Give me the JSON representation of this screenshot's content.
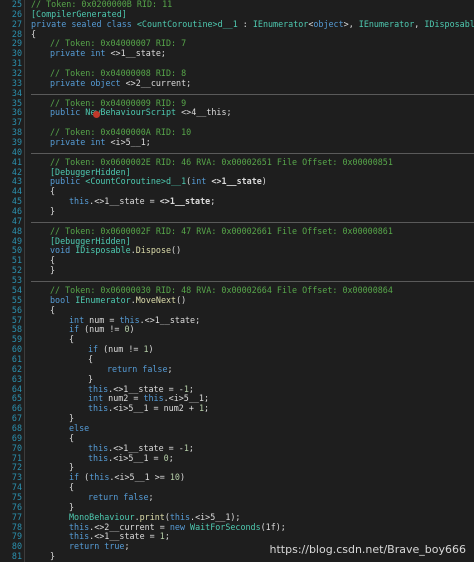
{
  "editor": {
    "lines": [
      {
        "n": "25",
        "i": 1,
        "segs": [
          [
            "c",
            "// Token: 0x0200000B RID: 11"
          ]
        ]
      },
      {
        "n": "26",
        "i": 1,
        "segs": [
          [
            "a",
            "[CompilerGenerated]"
          ]
        ]
      },
      {
        "n": "27",
        "i": 1,
        "segs": [
          [
            "k",
            "private sealed class "
          ],
          [
            "t",
            "<CountCoroutine>d__1"
          ],
          [
            "p",
            " : "
          ],
          [
            "t",
            "IEnumerator"
          ],
          [
            "p",
            "<"
          ],
          [
            "k",
            "object"
          ],
          [
            "p",
            ">, "
          ],
          [
            "t",
            "IEnumerator"
          ],
          [
            "p",
            ", "
          ],
          [
            "t",
            "IDisposable"
          ]
        ]
      },
      {
        "n": "28",
        "i": 1,
        "segs": [
          [
            "p",
            "{"
          ]
        ]
      },
      {
        "n": "29",
        "i": 2,
        "segs": [
          [
            "c",
            "// Token: 0x04000007 RID: 7"
          ]
        ]
      },
      {
        "n": "30",
        "i": 2,
        "segs": [
          [
            "k",
            "private int "
          ],
          [
            "p",
            "<>1__state;"
          ]
        ]
      },
      {
        "n": "31",
        "i": 0,
        "segs": []
      },
      {
        "n": "32",
        "i": 2,
        "segs": [
          [
            "c",
            "// Token: 0x04000008 RID: 8"
          ]
        ]
      },
      {
        "n": "33",
        "i": 2,
        "segs": [
          [
            "k",
            "private object "
          ],
          [
            "p",
            "<>2__current;"
          ]
        ]
      },
      {
        "n": "34",
        "i": 0,
        "segs": []
      },
      {
        "n": "35",
        "i": 2,
        "segs": [
          [
            "c",
            "// Token: 0x04000009 RID: 9"
          ]
        ]
      },
      {
        "n": "36",
        "i": 2,
        "segs": [
          [
            "k",
            "public "
          ],
          [
            "t",
            "NewBehaviourScript"
          ],
          [
            "p",
            " <>4__this;"
          ]
        ]
      },
      {
        "n": "37",
        "i": 0,
        "segs": []
      },
      {
        "n": "38",
        "i": 2,
        "segs": [
          [
            "c",
            "// Token: 0x0400000A RID: 10"
          ]
        ]
      },
      {
        "n": "39",
        "i": 2,
        "segs": [
          [
            "k",
            "private int "
          ],
          [
            "p",
            "<i>5__1;"
          ]
        ]
      },
      {
        "n": "40",
        "i": 0,
        "segs": []
      },
      {
        "n": "41",
        "i": 2,
        "segs": [
          [
            "c",
            "// Token: 0x0600002E RID: 46 RVA: 0x00002651 File Offset: 0x00000851"
          ]
        ]
      },
      {
        "n": "42",
        "i": 2,
        "segs": [
          [
            "a",
            "[DebuggerHidden]"
          ]
        ]
      },
      {
        "n": "43",
        "i": 2,
        "segs": [
          [
            "k",
            "public "
          ],
          [
            "t",
            "<CountCoroutine>d__1"
          ],
          [
            "p",
            "("
          ],
          [
            "k",
            "int "
          ],
          [
            "bold",
            "<>1__state"
          ],
          [
            "p",
            ")"
          ]
        ]
      },
      {
        "n": "44",
        "i": 2,
        "segs": [
          [
            "p",
            "{"
          ]
        ]
      },
      {
        "n": "45",
        "i": 3,
        "segs": [
          [
            "k",
            "this"
          ],
          [
            "p",
            ".<>1__state = "
          ],
          [
            "bold",
            "<>1__state"
          ],
          [
            "p",
            ";"
          ]
        ]
      },
      {
        "n": "46",
        "i": 2,
        "segs": [
          [
            "p",
            "}"
          ]
        ]
      },
      {
        "n": "47",
        "i": 0,
        "segs": []
      },
      {
        "n": "48",
        "i": 2,
        "segs": [
          [
            "c",
            "// Token: 0x0600002F RID: 47 RVA: 0x00002661 File Offset: 0x00000861"
          ]
        ]
      },
      {
        "n": "49",
        "i": 2,
        "segs": [
          [
            "a",
            "[DebuggerHidden]"
          ]
        ]
      },
      {
        "n": "50",
        "i": 2,
        "segs": [
          [
            "k",
            "void "
          ],
          [
            "t",
            "IDisposable"
          ],
          [
            "p",
            "."
          ],
          [
            "m",
            "Dispose"
          ],
          [
            "p",
            "()"
          ]
        ]
      },
      {
        "n": "51",
        "i": 2,
        "segs": [
          [
            "p",
            "{"
          ]
        ]
      },
      {
        "n": "52",
        "i": 2,
        "segs": [
          [
            "p",
            "}"
          ]
        ]
      },
      {
        "n": "53",
        "i": 0,
        "segs": []
      },
      {
        "n": "54",
        "i": 2,
        "segs": [
          [
            "c",
            "// Token: 0x06000030 RID: 48 RVA: 0x00002664 File Offset: 0x00000864"
          ]
        ]
      },
      {
        "n": "55",
        "i": 2,
        "segs": [
          [
            "k",
            "bool "
          ],
          [
            "t",
            "IEnumerator"
          ],
          [
            "p",
            "."
          ],
          [
            "m",
            "MoveNext"
          ],
          [
            "p",
            "()"
          ]
        ]
      },
      {
        "n": "56",
        "i": 2,
        "segs": [
          [
            "p",
            "{"
          ]
        ]
      },
      {
        "n": "57",
        "i": 3,
        "segs": [
          [
            "k",
            "int "
          ],
          [
            "p",
            "num = "
          ],
          [
            "k",
            "this"
          ],
          [
            "p",
            ".<>1__state;"
          ]
        ]
      },
      {
        "n": "58",
        "i": 3,
        "segs": [
          [
            "k",
            "if "
          ],
          [
            "p",
            "(num != "
          ],
          [
            "n",
            "0"
          ],
          [
            "p",
            ")"
          ]
        ]
      },
      {
        "n": "59",
        "i": 3,
        "segs": [
          [
            "p",
            "{"
          ]
        ]
      },
      {
        "n": "60",
        "i": 4,
        "segs": [
          [
            "k",
            "if "
          ],
          [
            "p",
            "(num != "
          ],
          [
            "n",
            "1"
          ],
          [
            "p",
            ")"
          ]
        ]
      },
      {
        "n": "61",
        "i": 4,
        "segs": [
          [
            "p",
            "{"
          ]
        ]
      },
      {
        "n": "62",
        "i": 5,
        "segs": [
          [
            "k",
            "return false"
          ],
          [
            "p",
            ";"
          ]
        ]
      },
      {
        "n": "63",
        "i": 4,
        "segs": [
          [
            "p",
            "}"
          ]
        ]
      },
      {
        "n": "64",
        "i": 4,
        "segs": [
          [
            "k",
            "this"
          ],
          [
            "p",
            ".<>1__state = -"
          ],
          [
            "n",
            "1"
          ],
          [
            "p",
            ";"
          ]
        ]
      },
      {
        "n": "65",
        "i": 4,
        "segs": [
          [
            "k",
            "int "
          ],
          [
            "p",
            "num2 = "
          ],
          [
            "k",
            "this"
          ],
          [
            "p",
            ".<i>5__1;"
          ]
        ]
      },
      {
        "n": "66",
        "i": 4,
        "segs": [
          [
            "k",
            "this"
          ],
          [
            "p",
            ".<i>5__1 = num2 + "
          ],
          [
            "n",
            "1"
          ],
          [
            "p",
            ";"
          ]
        ]
      },
      {
        "n": "67",
        "i": 3,
        "segs": [
          [
            "p",
            "}"
          ]
        ]
      },
      {
        "n": "68",
        "i": 3,
        "segs": [
          [
            "k",
            "else"
          ]
        ]
      },
      {
        "n": "69",
        "i": 3,
        "segs": [
          [
            "p",
            "{"
          ]
        ]
      },
      {
        "n": "70",
        "i": 4,
        "segs": [
          [
            "k",
            "this"
          ],
          [
            "p",
            ".<>1__state = -"
          ],
          [
            "n",
            "1"
          ],
          [
            "p",
            ";"
          ]
        ]
      },
      {
        "n": "71",
        "i": 4,
        "segs": [
          [
            "k",
            "this"
          ],
          [
            "p",
            ".<i>5__1 = "
          ],
          [
            "n",
            "0"
          ],
          [
            "p",
            ";"
          ]
        ]
      },
      {
        "n": "72",
        "i": 3,
        "segs": [
          [
            "p",
            "}"
          ]
        ]
      },
      {
        "n": "73",
        "i": 3,
        "segs": [
          [
            "k",
            "if "
          ],
          [
            "p",
            "("
          ],
          [
            "k",
            "this"
          ],
          [
            "p",
            ".<i>5__1 >= "
          ],
          [
            "n",
            "10"
          ],
          [
            "p",
            ")"
          ]
        ]
      },
      {
        "n": "74",
        "i": 3,
        "segs": [
          [
            "p",
            "{"
          ]
        ]
      },
      {
        "n": "75",
        "i": 4,
        "segs": [
          [
            "k",
            "return false"
          ],
          [
            "p",
            ";"
          ]
        ]
      },
      {
        "n": "76",
        "i": 3,
        "segs": [
          [
            "p",
            "}"
          ]
        ]
      },
      {
        "n": "77",
        "i": 3,
        "segs": [
          [
            "t",
            "MonoBehaviour"
          ],
          [
            "p",
            "."
          ],
          [
            "m",
            "print"
          ],
          [
            "p",
            "("
          ],
          [
            "k",
            "this"
          ],
          [
            "p",
            ".<i>5__1);"
          ]
        ]
      },
      {
        "n": "78",
        "i": 3,
        "segs": [
          [
            "k",
            "this"
          ],
          [
            "p",
            ".<>2__current = "
          ],
          [
            "k",
            "new "
          ],
          [
            "t",
            "WaitForSeconds"
          ],
          [
            "p",
            "(1f);"
          ]
        ]
      },
      {
        "n": "79",
        "i": 3,
        "segs": [
          [
            "k",
            "this"
          ],
          [
            "p",
            ".<>1__state = "
          ],
          [
            "n",
            "1"
          ],
          [
            "p",
            ";"
          ]
        ]
      },
      {
        "n": "80",
        "i": 3,
        "segs": [
          [
            "k",
            "return true"
          ],
          [
            "p",
            ";"
          ]
        ]
      },
      {
        "n": "81",
        "i": 2,
        "segs": [
          [
            "p",
            "}"
          ]
        ]
      }
    ]
  },
  "watermark": "https://blog.csdn.net/Brave_boy666",
  "colors": {
    "background": "#1e1e1e",
    "line_numbers": "#2b91af",
    "comment": "#57a64a",
    "keyword": "#569cd6",
    "type": "#4ec9b0",
    "method": "#dcdcaa",
    "number": "#b5cea8"
  }
}
